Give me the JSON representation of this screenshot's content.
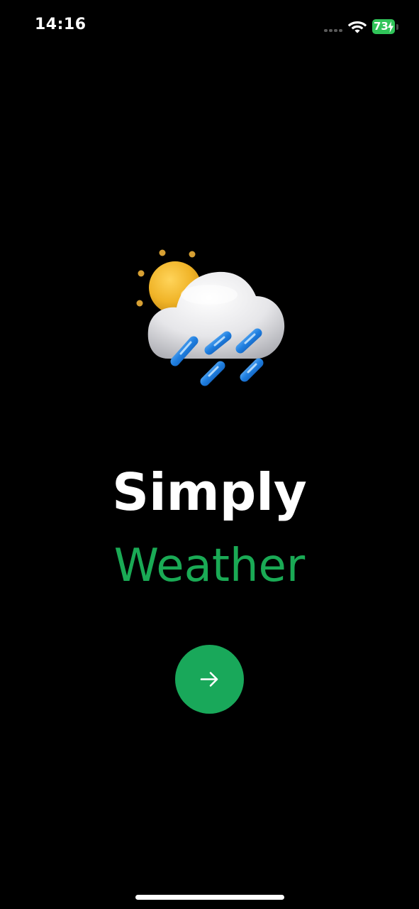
{
  "status_bar": {
    "time": "14:16",
    "battery_level": "73",
    "battery_color": "#30c459",
    "signal_icon": "cellular-dots-icon",
    "wifi_icon": "wifi-icon",
    "charging_icon": "charging-bolt-icon"
  },
  "hero": {
    "illustration_icon": "sun-behind-rain-cloud-icon"
  },
  "title": {
    "line1": "Simply",
    "line2": "Weather",
    "line1_color": "#ffffff",
    "line2_color": "#1aaa55"
  },
  "next_button": {
    "icon": "arrow-right-icon",
    "color": "#19a85a"
  },
  "theme": {
    "background": "#000000"
  }
}
